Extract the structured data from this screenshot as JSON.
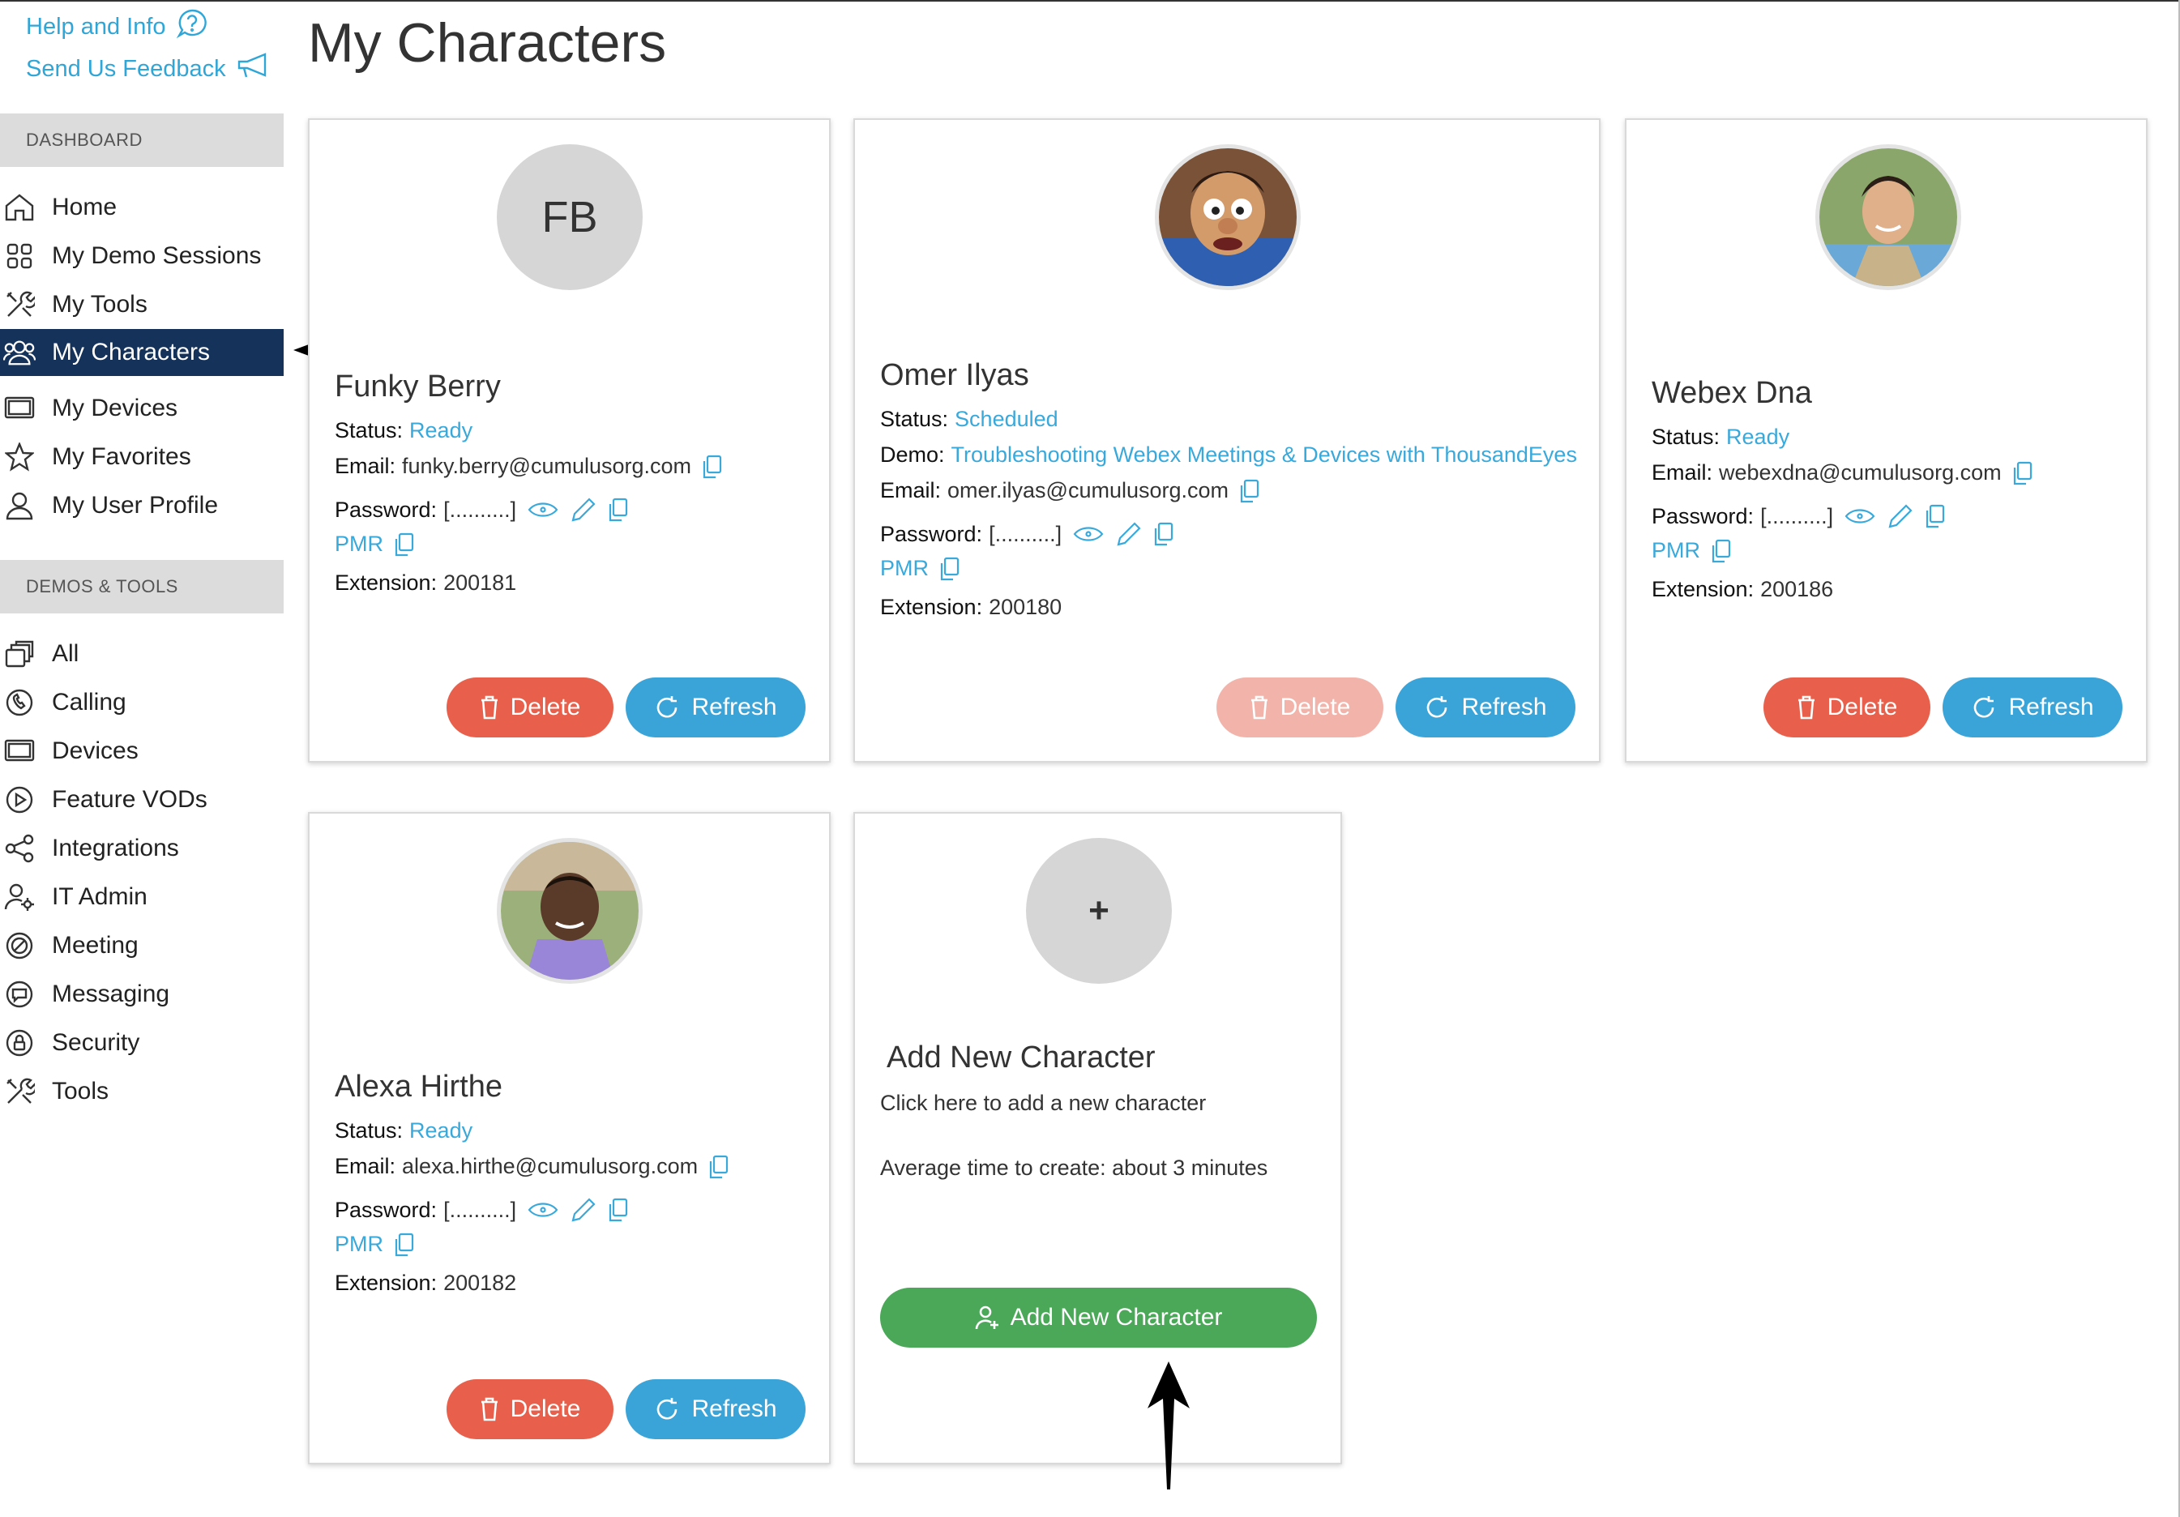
{
  "app": {
    "page_title": "My Characters"
  },
  "sidebar": {
    "help_label": "Help and Info",
    "feedback_label": "Send Us Feedback",
    "section_dashboard": "DASHBOARD",
    "section_demos": "DEMOS & TOOLS",
    "dashboard_items": [
      {
        "label": "Home",
        "icon": "home-icon"
      },
      {
        "label": "My Demo Sessions",
        "icon": "grid-icon"
      },
      {
        "label": "My Tools",
        "icon": "tools-icon"
      },
      {
        "label": "My Characters",
        "icon": "people-icon",
        "active": true
      },
      {
        "label": "My Devices",
        "icon": "device-icon"
      },
      {
        "label": "My Favorites",
        "icon": "star-icon"
      },
      {
        "label": "My User Profile",
        "icon": "user-icon"
      }
    ],
    "demo_items": [
      {
        "label": "All",
        "icon": "layers-icon"
      },
      {
        "label": "Calling",
        "icon": "calling-icon"
      },
      {
        "label": "Devices",
        "icon": "device-icon"
      },
      {
        "label": "Feature VODs",
        "icon": "play-icon"
      },
      {
        "label": "Integrations",
        "icon": "share-icon"
      },
      {
        "label": "IT Admin",
        "icon": "admin-icon"
      },
      {
        "label": "Meeting",
        "icon": "meeting-icon"
      },
      {
        "label": "Messaging",
        "icon": "messaging-icon"
      },
      {
        "label": "Security",
        "icon": "lock-icon"
      },
      {
        "label": "Tools",
        "icon": "tools-icon"
      }
    ]
  },
  "labels": {
    "status": "Status:",
    "email": "Email:",
    "password": "Password:",
    "password_mask": "[..........]",
    "pmr": "PMR",
    "extension": "Extension:",
    "demo": "Demo:",
    "delete": "Delete",
    "refresh": "Refresh"
  },
  "characters": [
    {
      "name": "Funky Berry",
      "initials": "FB",
      "status": "Ready",
      "email": "funky.berry@cumulusorg.com",
      "extension": "200181"
    },
    {
      "name": "Omer Ilyas",
      "status": "Scheduled",
      "demo": "Troubleshooting Webex Meetings & Devices with ThousandEyes",
      "email": "omer.ilyas@cumulusorg.com",
      "extension": "200180"
    },
    {
      "name": "Webex Dna",
      "status": "Ready",
      "email": "webexdna@cumulusorg.com",
      "extension": "200186"
    },
    {
      "name": "Alexa Hirthe",
      "status": "Ready",
      "email": "alexa.hirthe@cumulusorg.com",
      "extension": "200182"
    }
  ],
  "add_card": {
    "plus": "+",
    "title": "Add New Character",
    "description": "Click here to add a new character",
    "time_note": "Average time to create: about 3 minutes",
    "button_label": "Add New Character"
  },
  "colors": {
    "accent_link": "#39a9dc",
    "sidebar_active": "#14325a",
    "delete": "#e8604c",
    "refresh": "#3aa3d8",
    "add": "#4aa858"
  }
}
